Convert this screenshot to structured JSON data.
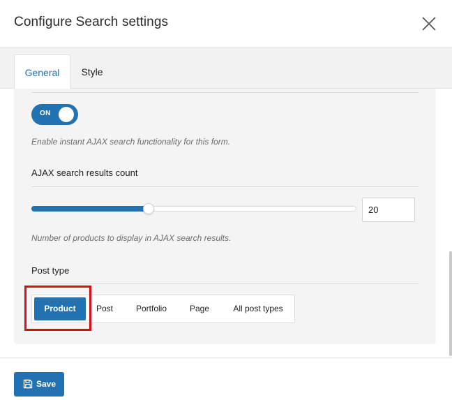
{
  "dialog": {
    "title": "Configure Search settings",
    "close_icon": "close-icon"
  },
  "tabs": [
    {
      "label": "General",
      "active": true
    },
    {
      "label": "Style",
      "active": false
    }
  ],
  "ajax": {
    "toggle_label": "ON",
    "toggle_state": true,
    "help": "Enable instant AJAX search functionality for this form."
  },
  "results": {
    "label": "AJAX search results count",
    "value": "20",
    "slider_fraction": 0.36,
    "help": "Number of products to display in AJAX search results."
  },
  "post_type": {
    "label": "Post type",
    "options": [
      "Product",
      "Post",
      "Portfolio",
      "Page",
      "All post types"
    ],
    "selected": "Product"
  },
  "footer": {
    "save_label": "Save",
    "save_icon": "save-icon"
  },
  "colors": {
    "accent": "#2271b1",
    "highlight": "#d60f16"
  }
}
